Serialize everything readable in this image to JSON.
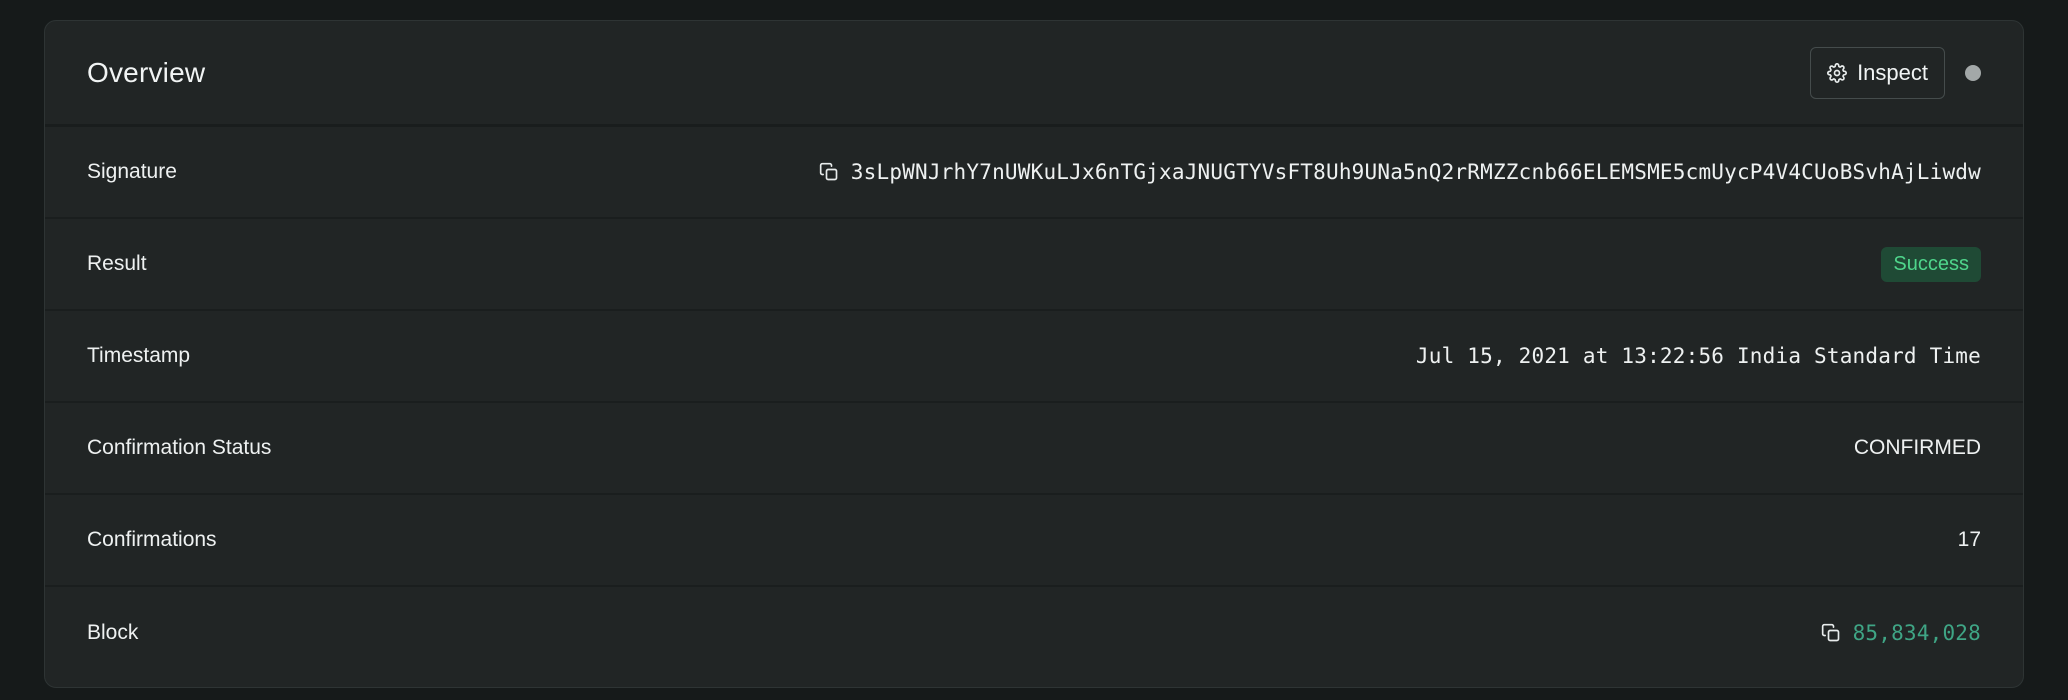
{
  "card": {
    "title": "Overview",
    "inspect_label": "Inspect"
  },
  "rows": {
    "signature": {
      "label": "Signature",
      "value": "3sLpWNJrhY7nUWKuLJx6nTGjxaJNUGTYVsFT8Uh9UNa5nQ2rRMZZcnb66ELEMSME5cmUycP4V4CUoBSvhAjLiwdw"
    },
    "result": {
      "label": "Result",
      "value": "Success"
    },
    "timestamp": {
      "label": "Timestamp",
      "value": "Jul 15, 2021 at 13:22:56 India Standard Time"
    },
    "confirmation_status": {
      "label": "Confirmation Status",
      "value": "CONFIRMED"
    },
    "confirmations": {
      "label": "Confirmations",
      "value": "17"
    },
    "block": {
      "label": "Block",
      "value": "85,834,028"
    }
  },
  "icons": {
    "inspect": "gear-icon",
    "copy": "copy-icon"
  },
  "colors": {
    "background": "#161a1a",
    "card": "#212525",
    "success_bg": "#1f4a35",
    "success_text": "#4fd58b",
    "link": "#3fa585",
    "status_dot": "#a3a8a8"
  }
}
